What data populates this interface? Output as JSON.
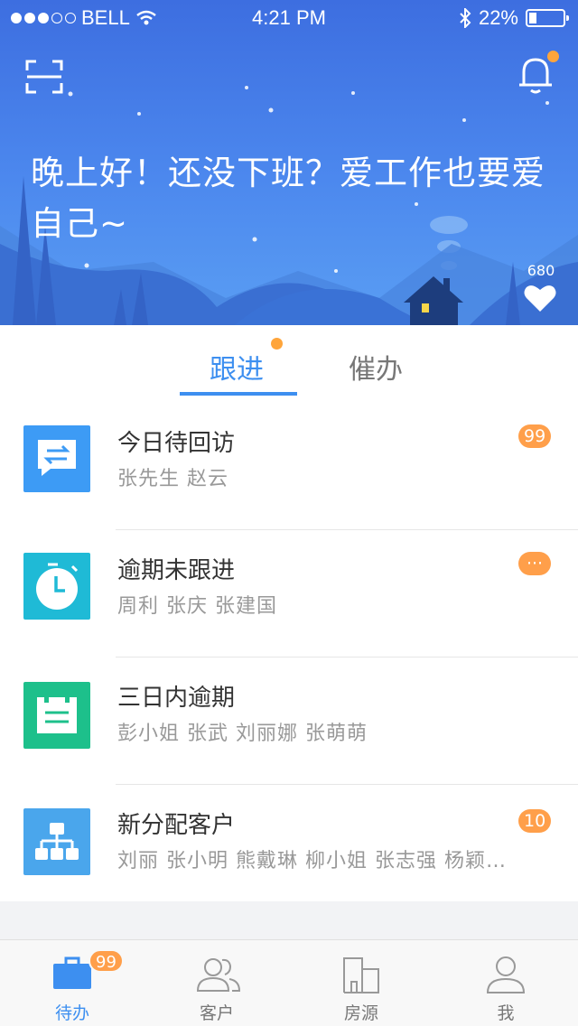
{
  "status_bar": {
    "carrier": "BELL",
    "time": "4:21 PM",
    "battery": "22%",
    "battery_level": 0.22,
    "signal_bars": 3,
    "signal_total": 5
  },
  "header": {
    "greeting": "晚上好！还没下班？爱工作也要爱自己~",
    "likes_count": "680",
    "icons": [
      "scan-icon",
      "bell-icon",
      "heart-icon"
    ],
    "notification_dot_color": "#ffa53b"
  },
  "tabs": [
    {
      "label": "跟进",
      "active": true
    },
    {
      "label": "催办",
      "active": false
    }
  ],
  "list": [
    {
      "title": "今日待回访",
      "names": "张先生  赵云",
      "badge": "99",
      "icon": "message-exchange-icon",
      "color": "#3d9bf5"
    },
    {
      "title": "逾期未跟进",
      "names": "周利  张庆  张建国",
      "badge": "···",
      "icon": "alarm-clock-icon",
      "color": "#1fbad6"
    },
    {
      "title": "三日内逾期",
      "names": "彭小姐  张武  刘丽娜  张萌萌",
      "badge": "",
      "icon": "calendar-icon",
      "color": "#1dc08b"
    },
    {
      "title": "新分配客户",
      "names": "刘丽  张小明  熊戴琳  柳小姐  张志强  杨颖…",
      "badge": "10",
      "icon": "org-chart-icon",
      "color": "#4aa6ec"
    }
  ],
  "tab_bar": [
    {
      "label": "待办",
      "badge": "99",
      "active": true,
      "icon": "briefcase-icon"
    },
    {
      "label": "客户",
      "badge": "",
      "active": false,
      "icon": "customers-icon"
    },
    {
      "label": "房源",
      "badge": "",
      "active": false,
      "icon": "building-icon"
    },
    {
      "label": "我",
      "badge": "",
      "active": false,
      "icon": "profile-icon"
    }
  ],
  "colors": {
    "accent": "#3d8ff0",
    "badge": "#ff9f4a",
    "header_top": "#3d6ee0",
    "header_bottom": "#5a9ef3"
  }
}
